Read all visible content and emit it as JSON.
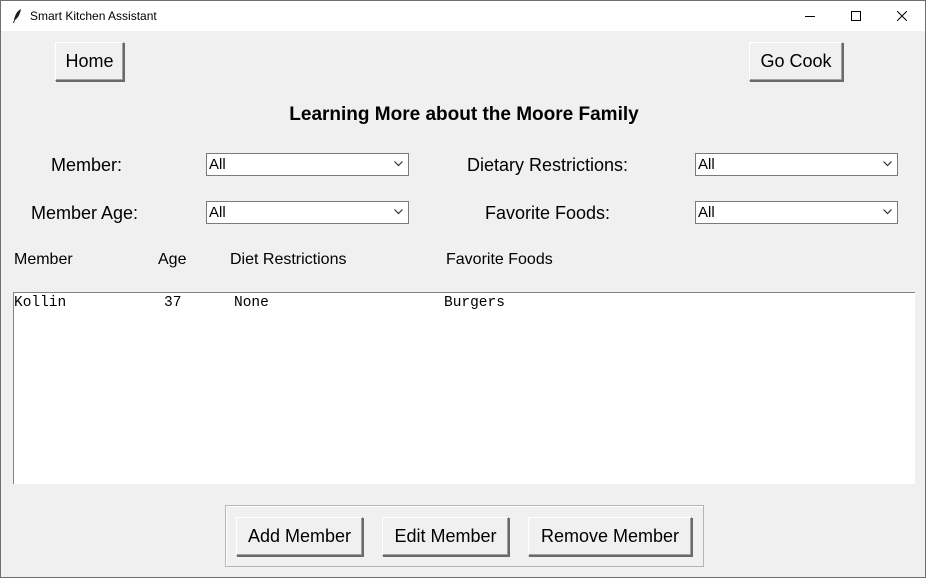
{
  "window": {
    "title": "Smart Kitchen Assistant",
    "icon": "feather-icon",
    "controls": [
      "minimize-icon",
      "maximize-icon",
      "close-icon"
    ]
  },
  "nav": {
    "home_label": "Home",
    "go_cook_label": "Go Cook"
  },
  "heading": "Learning More about the Moore Family",
  "filters": {
    "member": {
      "label": "Member:",
      "value": "All"
    },
    "dietary": {
      "label": "Dietary Restrictions:",
      "value": "All"
    },
    "age": {
      "label": "Member Age:",
      "value": "All"
    },
    "foods": {
      "label": "Favorite Foods:",
      "value": "All"
    }
  },
  "table": {
    "columns": [
      "Member",
      "Age",
      "Diet Restrictions",
      "Favorite Foods"
    ],
    "rows": [
      [
        "Kollin",
        "37",
        "None",
        "Burgers"
      ]
    ]
  },
  "actions": {
    "add_label": "Add Member",
    "edit_label": "Edit Member",
    "remove_label": "Remove Member"
  }
}
